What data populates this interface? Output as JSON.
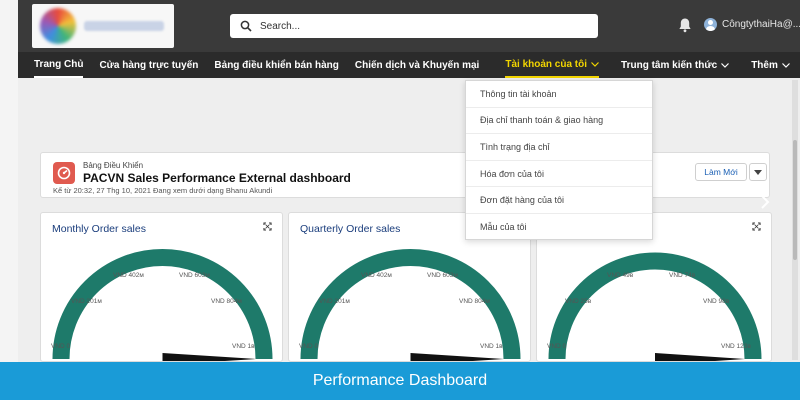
{
  "header": {
    "search_placeholder": "Search...",
    "user_name": "CôngtythaiHa@..."
  },
  "nav": {
    "items": [
      {
        "label": "Trang Chủ"
      },
      {
        "label": "Cửa hàng trực tuyến"
      },
      {
        "label": "Bảng điều khiển bán hàng"
      },
      {
        "label": "Chiến dịch và Khuyến mại"
      },
      {
        "label": "Tài khoản của tôi"
      },
      {
        "label": "Trung tâm kiến thức"
      },
      {
        "label": "Thêm"
      }
    ]
  },
  "dropdown": {
    "items": [
      {
        "label": "Thông tin tài khoản"
      },
      {
        "label": "Địa chỉ thanh toán & giao hàng"
      },
      {
        "label": "Tình trạng địa chỉ"
      },
      {
        "label": "Hóa đơn của tôi"
      },
      {
        "label": "Đơn đặt hàng của tôi"
      },
      {
        "label": "Mẫu của tôi"
      }
    ]
  },
  "dashboard": {
    "subtitle": "Bảng Điều Khiển",
    "title": "PACVN Sales Performance External dashboard",
    "meta": "Kể từ 20:32, 27 Thg 10, 2021 Đang xem dưới dạng Bhanu Akundi",
    "refresh_label": "Làm Mới"
  },
  "tiles": [
    {
      "title": "Monthly Order sales",
      "labels": {
        "t0": "VND 0",
        "t1": "VND 201м",
        "t2": "VND 402м",
        "t3": "VND 603м",
        "t4": "VND 804м",
        "t5": "VND 1в"
      },
      "value_fraction": 1.0
    },
    {
      "title": "Quarterly Order sales",
      "labels": {
        "t0": "VND 0",
        "t1": "VND 201м",
        "t2": "VND 402м",
        "t3": "VND 603м",
        "t4": "VND 804м",
        "t5": "VND 1в"
      },
      "value_fraction": 1.0
    },
    {
      "title": "",
      "labels": {
        "t0": "VND 0",
        "t1": "VND 25в",
        "t2": "VND 49в",
        "t3": "VND 74в",
        "t4": "VND 98в",
        "t5": "VND 123в"
      },
      "value_fraction": 1.0
    }
  ],
  "banner": {
    "text": "Performance Dashboard"
  },
  "colors": {
    "gauge": "#1e7a6a",
    "needle": "#111111",
    "nav_highlight": "#f2d500",
    "banner": "#1a9bd7"
  },
  "icons": {
    "search": "search-icon",
    "bell": "bell-icon",
    "dashboard": "dashboard-icon",
    "expand": "expand-icon",
    "chevron": "chevron-down-icon"
  }
}
